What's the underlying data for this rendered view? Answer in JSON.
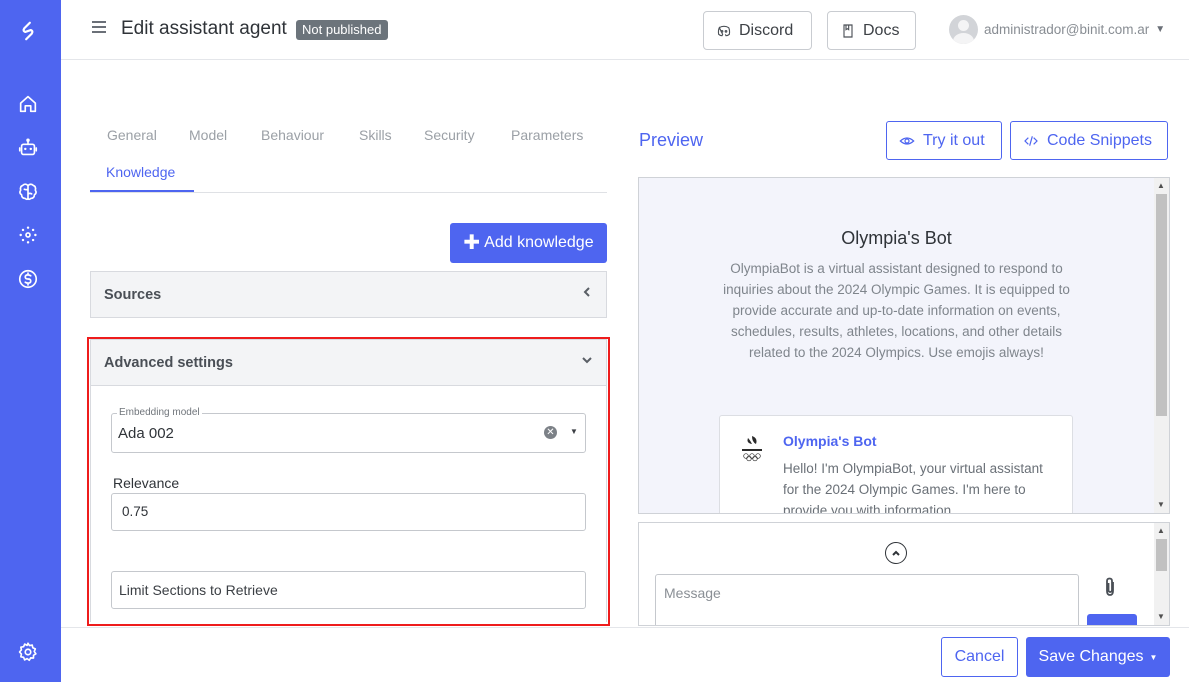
{
  "sidebar": {
    "items": [
      {
        "icon": "home-icon"
      },
      {
        "icon": "robot-icon"
      },
      {
        "icon": "brain-icon"
      },
      {
        "icon": "dots-network-icon"
      },
      {
        "icon": "dollar-icon"
      }
    ],
    "bottom_icon": "settings-gear-icon",
    "color": "#4e65f0"
  },
  "header": {
    "title": "Edit assistant agent",
    "status_badge": "Not published",
    "discord_label": "Discord",
    "docs_label": "Docs",
    "user_email": "administrador@binit.com.ar"
  },
  "tabs": [
    {
      "label": "General"
    },
    {
      "label": "Model"
    },
    {
      "label": "Behaviour"
    },
    {
      "label": "Skills"
    },
    {
      "label": "Security"
    },
    {
      "label": "Parameters"
    },
    {
      "label": "Knowledge",
      "active": true
    }
  ],
  "knowledge": {
    "add_button": "Add knowledge",
    "sources_title": "Sources",
    "advanced_title": "Advanced settings",
    "embedding": {
      "label": "Embedding model",
      "value": "Ada 002"
    },
    "relevance": {
      "label": "Relevance",
      "value": "0.75"
    },
    "limit_sections": {
      "value": "Limit Sections to Retrieve"
    }
  },
  "preview": {
    "title": "Preview",
    "try_label": "Try it out",
    "code_label": "Code Snippets",
    "bot_name": "Olympia's Bot",
    "bot_description": "OlympiaBot is a virtual assistant designed to respond to inquiries about the 2024 Olympic Games. It is equipped to provide accurate and up-to-date information on events, schedules, results, athletes, locations, and other details related to the 2024 Olympics. Use emojis always!",
    "message_author": "Olympia's Bot",
    "message_text": "Hello! I'm OlympiaBot, your virtual assistant for the 2024 Olympic Games. I'm here to provide you with information",
    "message_placeholder": "Message"
  },
  "footer": {
    "cancel_label": "Cancel",
    "save_label": "Save Changes"
  }
}
